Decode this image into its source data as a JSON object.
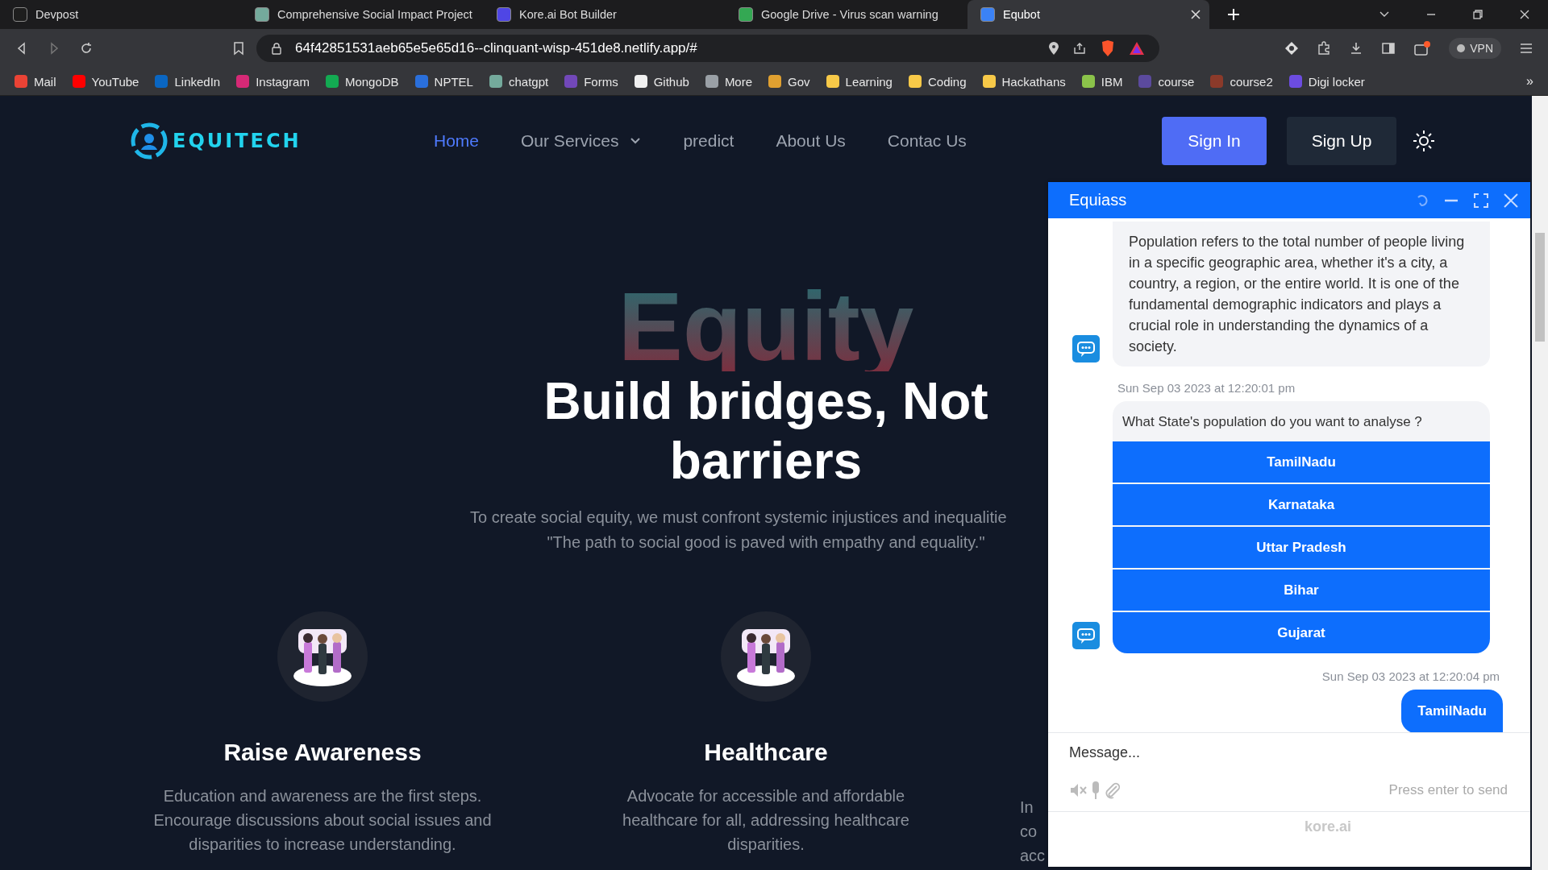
{
  "browser": {
    "tabs": [
      {
        "title": "Devpost",
        "selected": false,
        "color": "#1e1e1e"
      },
      {
        "title": "Comprehensive Social Impact Project",
        "selected": false,
        "color": "#74aa9c"
      },
      {
        "title": "Kore.ai Bot Builder",
        "selected": false,
        "color": "#4f46e5"
      },
      {
        "title": "Google Drive - Virus scan warning",
        "selected": false,
        "color": "#34a853"
      },
      {
        "title": "Equbot",
        "selected": true,
        "color": "#3b82f6"
      }
    ],
    "url": "64f42851531aeb65e5e65d16--clinquant-wisp-451de8.netlify.app/#",
    "vpn": "VPN",
    "bookmarks": [
      {
        "label": "Mail",
        "color": "#ea4335"
      },
      {
        "label": "YouTube",
        "color": "#ff0000"
      },
      {
        "label": "LinkedIn",
        "color": "#0a66c2"
      },
      {
        "label": "Instagram",
        "color": "#d62976"
      },
      {
        "label": "MongoDB",
        "color": "#13aa52"
      },
      {
        "label": "NPTEL",
        "color": "#2a6fdb"
      },
      {
        "label": "chatgpt",
        "color": "#74aa9c"
      },
      {
        "label": "Forms",
        "color": "#7248b9"
      },
      {
        "label": "Github",
        "color": "#f0f0f0"
      },
      {
        "label": "More",
        "color": "#9aa0a6"
      },
      {
        "label": "Gov",
        "color": "#e0a030"
      },
      {
        "label": "Learning",
        "color": "#f7c948"
      },
      {
        "label": "Coding",
        "color": "#f7c948"
      },
      {
        "label": "Hackathans",
        "color": "#f7c948"
      },
      {
        "label": "IBM",
        "color": "#8bc34a"
      },
      {
        "label": "course",
        "color": "#5b4a9e"
      },
      {
        "label": "course2",
        "color": "#8b3a2a"
      },
      {
        "label": "Digi locker",
        "color": "#6c4ce0"
      }
    ],
    "more": "»"
  },
  "header": {
    "nav": [
      {
        "label": "Home",
        "selected": true,
        "kind": "link"
      },
      {
        "label": "Our Services",
        "selected": false,
        "kind": "dropdown"
      },
      {
        "label": "predict",
        "selected": false,
        "kind": "link"
      },
      {
        "label": "About Us",
        "selected": false,
        "kind": "link"
      },
      {
        "label": "Contac Us",
        "selected": false,
        "kind": "link"
      }
    ],
    "sign_in": "Sign In",
    "sign_up": "Sign Up",
    "logo": "EQUITECH"
  },
  "hero": {
    "watermark": "Equity",
    "title": "Build bridges, Not barriers",
    "subtitle": [
      "To create social equity, we must confront systemic injustices and inequalitie",
      "\"The path to social good is paved with empathy and equality.\""
    ]
  },
  "cards": [
    {
      "title": "Raise Awareness",
      "description": "Education and awareness are the first steps. Encourage discussions about social issues and disparities to increase understanding."
    },
    {
      "title": "Healthcare",
      "description": "Advocate for accessible and affordable healthcare for all, addressing healthcare disparities."
    }
  ],
  "partial_card": {
    "lines": [
      "In",
      "co",
      "acc"
    ]
  },
  "chat": {
    "title": "Equiass",
    "messages": [
      {
        "kind": "bot_text",
        "text": "Population refers to the total number of people living in a specific geographic area, whether it's a city, a country, a region, or the entire world. It is one of the fundamental demographic indicators and plays a crucial role in understanding the dynamics of a society."
      },
      {
        "kind": "bot_timestamp",
        "text": "Sun Sep 03 2023 at 12:20:01 pm"
      },
      {
        "kind": "bot_options",
        "text": "What State's population do you want to analyse ?",
        "options": [
          "TamilNadu",
          "Karnataka",
          "Uttar Pradesh",
          "Bihar",
          "Gujarat"
        ]
      },
      {
        "kind": "user_timestamp",
        "text": "Sun Sep 03 2023 at 12:20:04 pm"
      },
      {
        "kind": "user_text",
        "text": "TamilNadu"
      }
    ],
    "input": {
      "placeholder": "Message..."
    },
    "hint": "Press enter to send",
    "brand": "kore.ai"
  }
}
